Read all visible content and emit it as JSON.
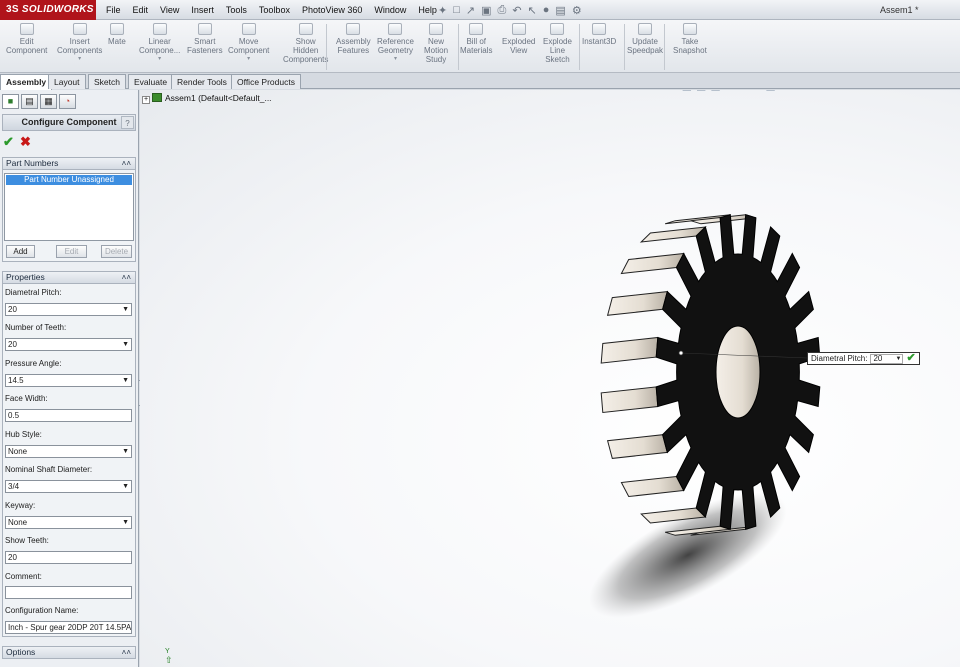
{
  "app": {
    "logo": "SOLIDWORKS",
    "logo_prefix": "3S",
    "document_title": "Assem1 *"
  },
  "menu": [
    "File",
    "Edit",
    "View",
    "Insert",
    "Tools",
    "Toolbox",
    "PhotoView 360",
    "Window",
    "Help"
  ],
  "commands": [
    {
      "label": "Edit Component",
      "lines": [
        "Edit",
        "Component"
      ]
    },
    {
      "label": "Insert Components",
      "lines": [
        "Insert",
        "Components"
      ]
    },
    {
      "label": "Mate",
      "lines": [
        "Mate"
      ]
    },
    {
      "label": "Linear Component Pattern",
      "lines": [
        "Linear",
        "Compone..."
      ]
    },
    {
      "label": "Smart Fasteners",
      "lines": [
        "Smart",
        "Fasteners"
      ]
    },
    {
      "label": "Move Component",
      "lines": [
        "Move",
        "Component"
      ]
    },
    {
      "label": "Show Hidden Components",
      "lines": [
        "Show",
        "Hidden",
        "Components"
      ]
    },
    {
      "label": "Assembly Features",
      "lines": [
        "Assembly",
        "Features"
      ]
    },
    {
      "label": "Reference Geometry",
      "lines": [
        "Reference",
        "Geometry"
      ]
    },
    {
      "label": "New Motion Study",
      "lines": [
        "New",
        "Motion",
        "Study"
      ]
    },
    {
      "label": "Bill of Materials",
      "lines": [
        "Bill of",
        "Materials"
      ]
    },
    {
      "label": "Exploded View",
      "lines": [
        "Exploded",
        "View"
      ]
    },
    {
      "label": "Explode Line Sketch",
      "lines": [
        "Explode",
        "Line",
        "Sketch"
      ]
    },
    {
      "label": "Instant3D",
      "lines": [
        "Instant3D"
      ]
    },
    {
      "label": "Update Speedpak",
      "lines": [
        "Update",
        "Speedpak"
      ]
    },
    {
      "label": "Take Snapshot",
      "lines": [
        "Take",
        "Snapshot"
      ]
    }
  ],
  "tabs": [
    "Assembly",
    "Layout",
    "Sketch",
    "Evaluate",
    "Render Tools",
    "Office Products"
  ],
  "property_manager": {
    "title": "Configure Component",
    "help": "?",
    "part_numbers": {
      "header": "Part Numbers",
      "selected": "Part Number Unassigned",
      "add": "Add",
      "edit": "Edit",
      "delete": "Delete"
    },
    "properties": {
      "header": "Properties",
      "diametral_pitch_label": "Diametral Pitch:",
      "diametral_pitch": "20",
      "teeth_label": "Number of Teeth:",
      "teeth": "20",
      "pressure_angle_label": "Pressure Angle:",
      "pressure_angle": "14.5",
      "face_width_label": "Face Width:",
      "face_width": "0.5",
      "hub_style_label": "Hub Style:",
      "hub_style": "None",
      "shaft_label": "Nominal Shaft Diameter:",
      "shaft": "3/4",
      "keyway_label": "Keyway:",
      "keyway": "None",
      "show_teeth_label": "Show Teeth:",
      "show_teeth": "20",
      "comment_label": "Comment:",
      "comment": "",
      "config_label": "Configuration Name:",
      "config": "Inch - Spur gear 20DP 20T 14.5PA"
    },
    "options": {
      "header": "Options"
    }
  },
  "tree": {
    "root": "Assem1  (Default<Default_..."
  },
  "callout": {
    "label": "Diametral Pitch:",
    "value": "20"
  },
  "triad": {
    "y": "Y"
  }
}
